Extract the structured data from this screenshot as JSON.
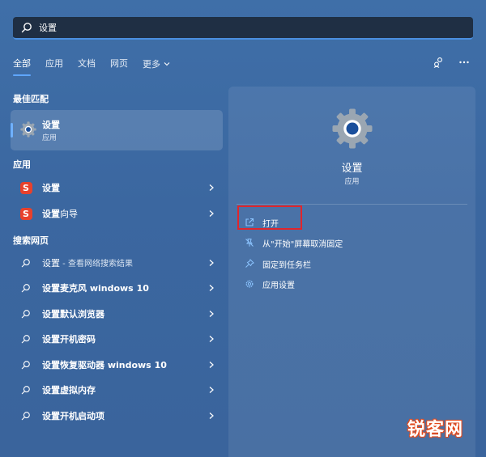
{
  "search": {
    "value": "设置",
    "icon": "search-icon"
  },
  "tabs": [
    {
      "label": "全部",
      "active": true
    },
    {
      "label": "应用"
    },
    {
      "label": "文档"
    },
    {
      "label": "网页"
    },
    {
      "label": "更多"
    }
  ],
  "sections": {
    "best_match": "最佳匹配",
    "apps": "应用",
    "web": "搜索网页"
  },
  "best_match": {
    "name": "设置",
    "type": "应用"
  },
  "apps": [
    {
      "name": "设置"
    },
    {
      "name_bold": "设置",
      "name_rest": "向导"
    }
  ],
  "web": [
    {
      "bold": "设置",
      "rest": " - 查看网络搜索结果"
    },
    {
      "bold": "设置麦克风 windows 10",
      "rest": ""
    },
    {
      "bold": "设置默认浏览器",
      "rest": ""
    },
    {
      "bold": "设置开机密码",
      "rest": ""
    },
    {
      "bold": "设置恢复驱动器 windows 10",
      "rest": ""
    },
    {
      "bold": "设置虚拟内存",
      "rest": ""
    },
    {
      "bold": "设置开机启动项",
      "rest": ""
    }
  ],
  "panel": {
    "name": "设置",
    "type": "应用",
    "actions": [
      {
        "label": "打开",
        "icon": "open-external-icon"
      },
      {
        "label": "从\"开始\"屏幕取消固定",
        "icon": "unpin-icon"
      },
      {
        "label": "固定到任务栏",
        "icon": "pin-icon"
      },
      {
        "label": "应用设置",
        "icon": "gear-icon"
      }
    ]
  },
  "watermark": "锐客网",
  "colors": {
    "accent": "#5fa6ff",
    "highlight": "#e0262c",
    "brand_s": "#e8412c"
  }
}
